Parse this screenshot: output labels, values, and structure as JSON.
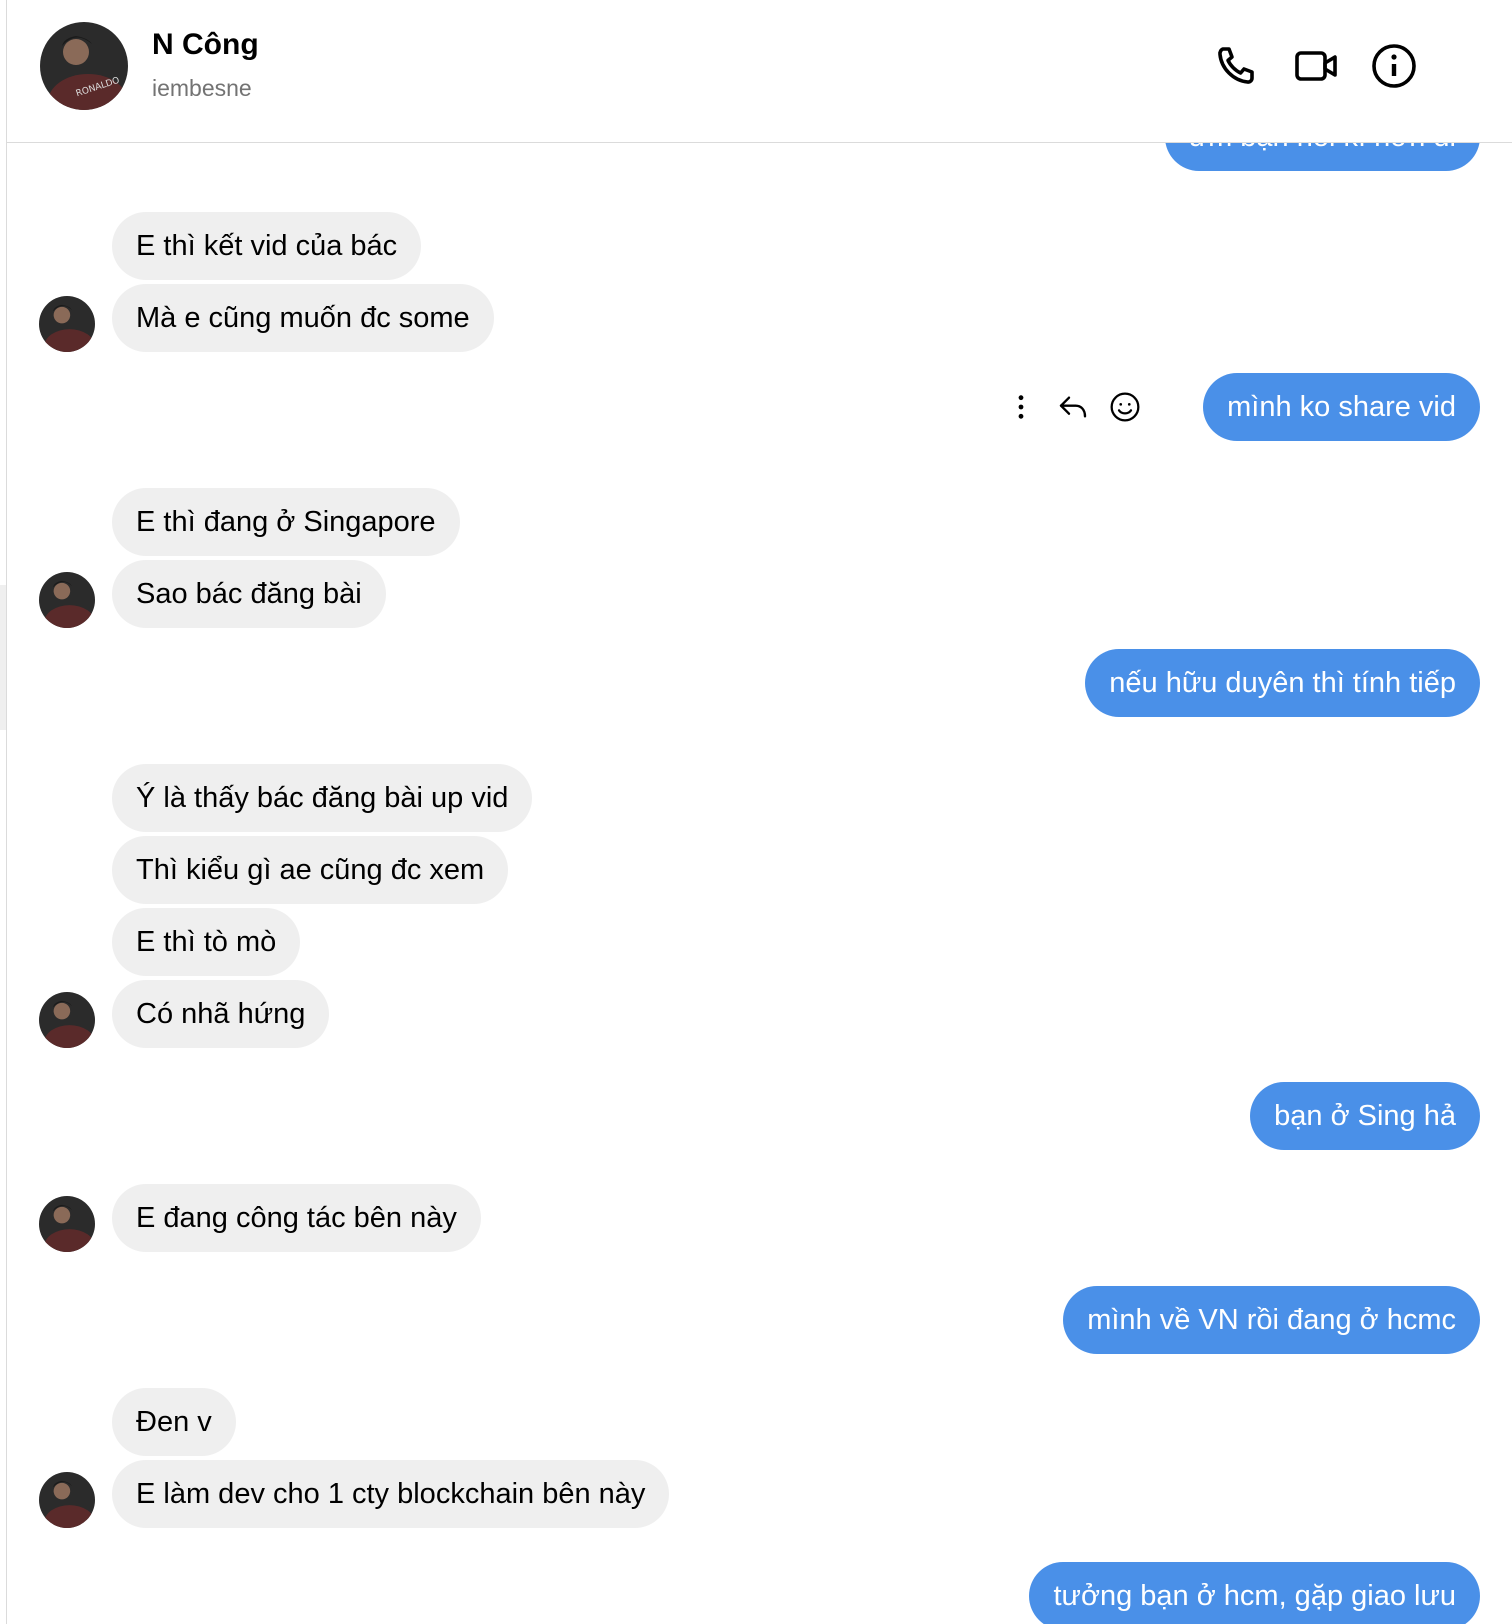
{
  "header": {
    "name": "N Công",
    "username": "iembesne",
    "avatar_text": "RONALDO"
  },
  "thread": {
    "partial_top_message": "ừm bạn nói kĩ hơn đi",
    "messages": [
      {
        "from": "them",
        "text": "E thì kết vid của bác"
      },
      {
        "from": "them",
        "text": "Mà e cũng muốn đc some"
      },
      {
        "from": "me",
        "text": "mình ko share vid"
      },
      {
        "from": "them",
        "text": "E thì đang ở Singapore"
      },
      {
        "from": "them",
        "text": "Sao bác đăng bài"
      },
      {
        "from": "me",
        "text": "nếu hữu duyên thì tính tiếp"
      },
      {
        "from": "them",
        "text": "Ý là thấy bác đăng bài up vid"
      },
      {
        "from": "them",
        "text": "Thì kiểu gì ae cũng đc xem"
      },
      {
        "from": "them",
        "text": "E thì tò mò"
      },
      {
        "from": "them",
        "text": "Có nhã hứng"
      },
      {
        "from": "me",
        "text": "bạn ở Sing hả"
      },
      {
        "from": "them",
        "text": "E đang công tác bên này"
      },
      {
        "from": "me",
        "text": "mình về VN rồi đang ở hcmc"
      },
      {
        "from": "them",
        "text": "Đen v"
      },
      {
        "from": "them",
        "text": "E làm dev cho 1 cty blockchain bên này"
      },
      {
        "from": "me",
        "text": "tưởng bạn ở hcm, gặp giao lưu"
      }
    ]
  },
  "icons": {
    "call": "phone-icon",
    "video": "video-camera-icon",
    "info": "info-icon",
    "more": "more-vertical-icon",
    "reply": "reply-icon",
    "react": "emoji-icon"
  },
  "colors": {
    "outgoing_bubble": "#4a90e8",
    "incoming_bubble": "#efefef",
    "secondary_text": "#737373"
  }
}
